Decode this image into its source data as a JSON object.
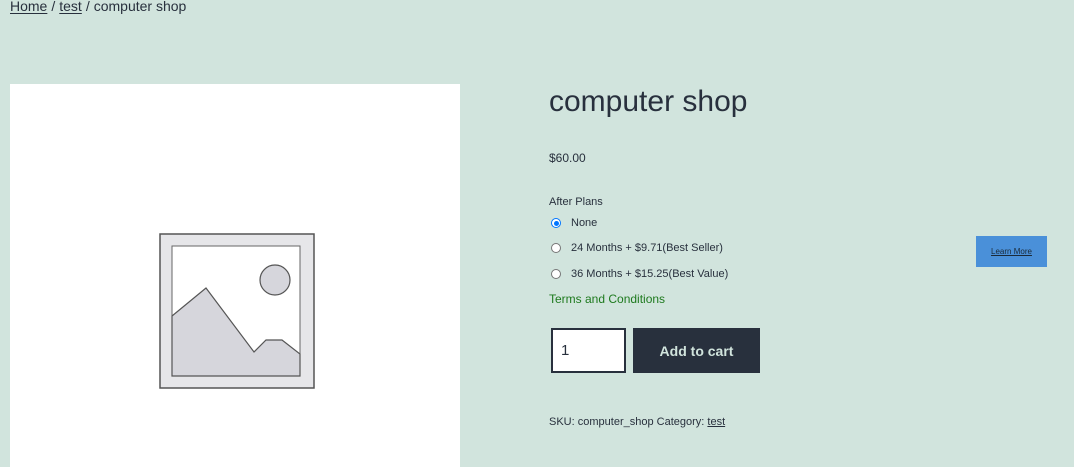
{
  "breadcrumb": {
    "home": "Home",
    "separator": "/",
    "category": "test",
    "current": "computer shop"
  },
  "image": {
    "icon": "image-placeholder-icon"
  },
  "product": {
    "title": "computer shop",
    "price": "$60.00",
    "plans_label": "After Plans",
    "plans": [
      {
        "label": "None",
        "selected": true
      },
      {
        "label": "24 Months + $9.71(Best Seller)",
        "selected": false
      },
      {
        "label": "36 Months + $15.25(Best Value)",
        "selected": false
      }
    ],
    "terms_link": "Terms and Conditions",
    "quantity": "1",
    "add_to_cart_label": "Add to cart",
    "meta": {
      "sku_label": "SKU:",
      "sku_value": "computer_shop",
      "category_label": "Category:",
      "category_value": "test"
    }
  },
  "learn_more_label": "Learn More",
  "colors": {
    "background": "#d1e4dd",
    "text": "#28303d",
    "button": "#28303d",
    "terms_link": "#1e7a1e",
    "learn_more_bg": "#4a90d9",
    "radio_accent": "#0075ff"
  }
}
